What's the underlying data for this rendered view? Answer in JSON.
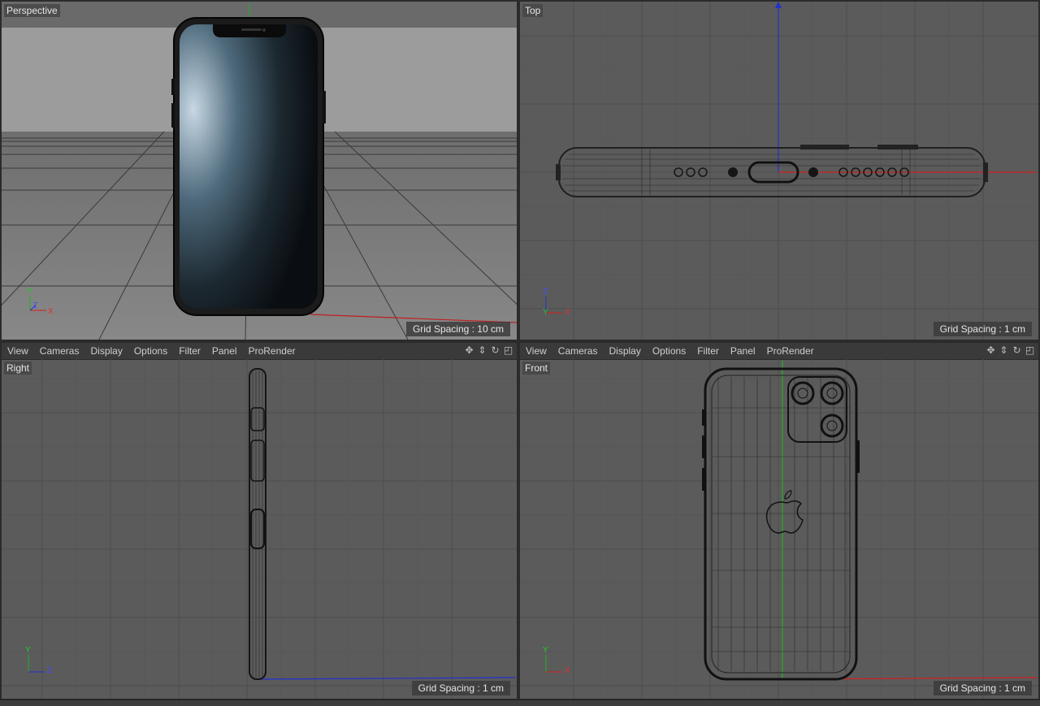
{
  "menu": [
    "View",
    "Cameras",
    "Display",
    "Options",
    "Filter",
    "Panel",
    "ProRender"
  ],
  "viewports": {
    "perspective": {
      "label": "Perspective",
      "grid": "Grid Spacing : 10 cm"
    },
    "top": {
      "label": "Top",
      "grid": "Grid Spacing : 1 cm"
    },
    "right": {
      "label": "Right",
      "grid": "Grid Spacing : 1 cm"
    },
    "front": {
      "label": "Front",
      "grid": "Grid Spacing : 1 cm"
    }
  },
  "axes": {
    "x": "X",
    "y": "Y",
    "z": "Z"
  },
  "icons": [
    "move-icon",
    "pan-icon",
    "rotate-icon",
    "maximize-icon"
  ],
  "colors": {
    "x_axis": "#d02020",
    "y_axis": "#20b020",
    "z_axis": "#2030d0",
    "viewport_bg": "#5b5b5b"
  }
}
